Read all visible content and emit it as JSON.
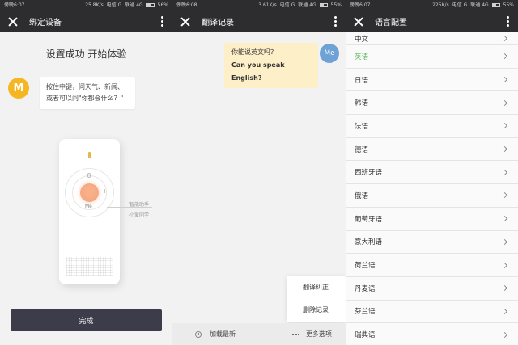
{
  "panel1": {
    "status": {
      "time": "傍晚6:07",
      "speed": "25.8K/s",
      "carrier": "电信 G",
      "carrier2": "联通 4G",
      "battery": "56%",
      "battery_level": 0.56
    },
    "title": "绑定设备",
    "success_text": "设置成功 开始体验",
    "logo_letter": "M",
    "hint_line1": "按住中键，问天气、新闻、",
    "hint_line2": "或者可以问\"你都会什么？\"",
    "device": {
      "me_label": "Me",
      "minus": "−",
      "plus": "+"
    },
    "callout1": "智能助手",
    "callout2": "小爱同学",
    "done_label": "完成"
  },
  "panel2": {
    "status": {
      "time": "傍晚6:08",
      "speed": "3.61K/s",
      "carrier": "电信 G",
      "carrier2": "联通 4G",
      "battery": "55%",
      "battery_level": 0.55
    },
    "title": "翻译记录",
    "bubble_zh": "你能说英文吗？",
    "bubble_en": "Can you speak English?",
    "avatar": "Me",
    "popup": [
      "翻译纠正",
      "删除记录"
    ],
    "load_latest": "加载最新",
    "more_options": "更多选项"
  },
  "panel3": {
    "status": {
      "time": "傍晚6:07",
      "speed": "225K/s",
      "carrier": "电信 G",
      "carrier2": "联通 4G",
      "battery": "55%",
      "battery_level": 0.55
    },
    "title": "语言配置",
    "languages": [
      "中文",
      "英语",
      "日语",
      "韩语",
      "法语",
      "德语",
      "西班牙语",
      "俄语",
      "葡萄牙语",
      "意大利语",
      "荷兰语",
      "丹麦语",
      "芬兰语",
      "瑞典语"
    ],
    "selected": "英语",
    "colors": {
      "selected": "#5cb85c"
    }
  }
}
